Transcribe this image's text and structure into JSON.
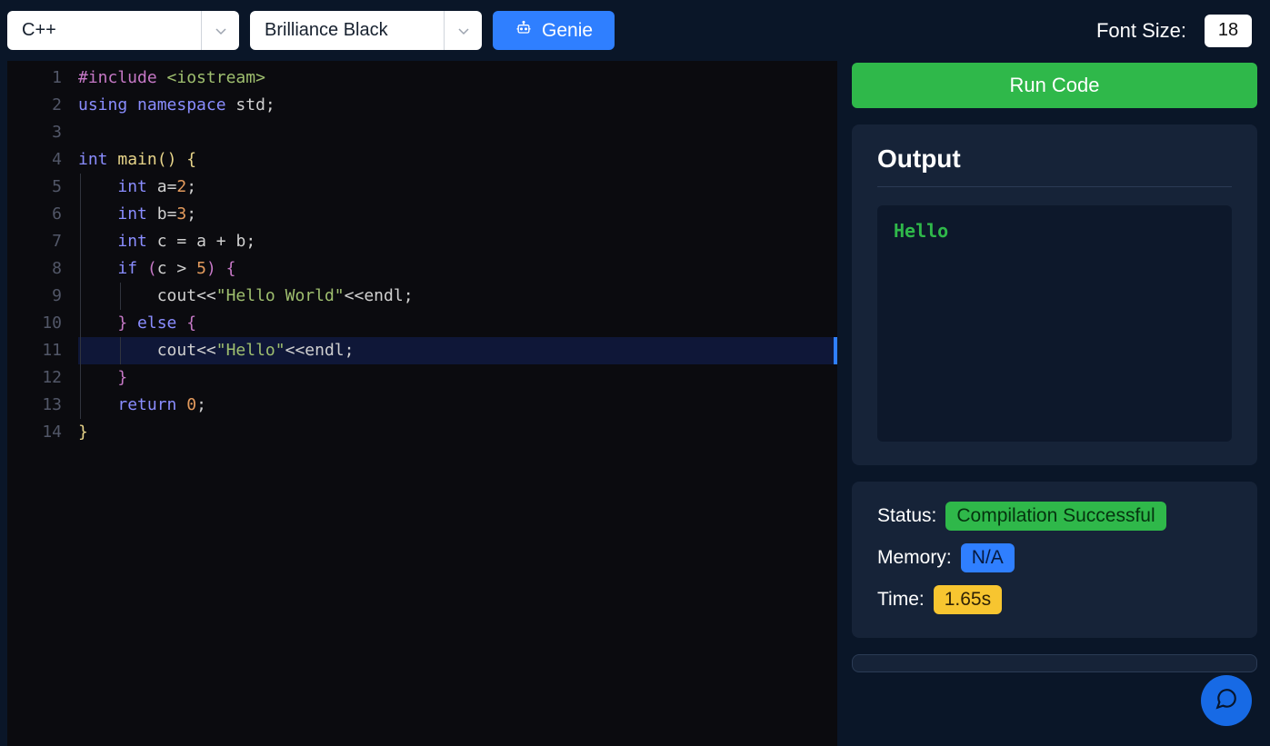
{
  "toolbar": {
    "language": "C++",
    "theme": "Brilliance Black",
    "genie_label": "Genie",
    "font_size_label": "Font Size:",
    "font_size_value": "18"
  },
  "editor": {
    "line_numbers": [
      "1",
      "2",
      "3",
      "4",
      "5",
      "6",
      "7",
      "8",
      "9",
      "10",
      "11",
      "12",
      "13",
      "14"
    ],
    "highlighted_line_index": 10,
    "lines": [
      {
        "tokens": [
          {
            "t": "#include ",
            "c": "include"
          },
          {
            "t": "<iostream>",
            "c": "str"
          }
        ]
      },
      {
        "tokens": [
          {
            "t": "using ",
            "c": "keyword"
          },
          {
            "t": "namespace ",
            "c": "keyword"
          },
          {
            "t": "std",
            "c": "ident"
          },
          {
            "t": ";",
            "c": "op"
          }
        ]
      },
      {
        "tokens": []
      },
      {
        "tokens": [
          {
            "t": "int ",
            "c": "type"
          },
          {
            "t": "main",
            "c": "func"
          },
          {
            "t": "(",
            "c": "punc-yellow"
          },
          {
            "t": ")",
            "c": "punc-yellow"
          },
          {
            "t": " ",
            "c": "plain"
          },
          {
            "t": "{",
            "c": "punc-yellow"
          }
        ]
      },
      {
        "indent": 1,
        "tokens": [
          {
            "t": "    ",
            "c": "plain"
          },
          {
            "t": "int ",
            "c": "type"
          },
          {
            "t": "a",
            "c": "ident"
          },
          {
            "t": "=",
            "c": "op"
          },
          {
            "t": "2",
            "c": "num"
          },
          {
            "t": ";",
            "c": "op"
          }
        ]
      },
      {
        "indent": 1,
        "tokens": [
          {
            "t": "    ",
            "c": "plain"
          },
          {
            "t": "int ",
            "c": "type"
          },
          {
            "t": "b",
            "c": "ident"
          },
          {
            "t": "=",
            "c": "op"
          },
          {
            "t": "3",
            "c": "num"
          },
          {
            "t": ";",
            "c": "op"
          }
        ]
      },
      {
        "indent": 1,
        "tokens": [
          {
            "t": "    ",
            "c": "plain"
          },
          {
            "t": "int ",
            "c": "type"
          },
          {
            "t": "c ",
            "c": "ident"
          },
          {
            "t": "= ",
            "c": "op"
          },
          {
            "t": "a ",
            "c": "ident"
          },
          {
            "t": "+ ",
            "c": "op"
          },
          {
            "t": "b",
            "c": "ident"
          },
          {
            "t": ";",
            "c": "op"
          }
        ]
      },
      {
        "indent": 1,
        "tokens": [
          {
            "t": "    ",
            "c": "plain"
          },
          {
            "t": "if ",
            "c": "keyword"
          },
          {
            "t": "(",
            "c": "punc-pink"
          },
          {
            "t": "c ",
            "c": "ident"
          },
          {
            "t": "> ",
            "c": "op"
          },
          {
            "t": "5",
            "c": "num"
          },
          {
            "t": ")",
            "c": "punc-pink"
          },
          {
            "t": " ",
            "c": "plain"
          },
          {
            "t": "{",
            "c": "punc-pink"
          }
        ]
      },
      {
        "indent": 2,
        "tokens": [
          {
            "t": "        ",
            "c": "plain"
          },
          {
            "t": "cout",
            "c": "ident"
          },
          {
            "t": "<<",
            "c": "op"
          },
          {
            "t": "\"Hello World\"",
            "c": "str"
          },
          {
            "t": "<<",
            "c": "op"
          },
          {
            "t": "endl",
            "c": "ident"
          },
          {
            "t": ";",
            "c": "op"
          }
        ]
      },
      {
        "indent": 1,
        "tokens": [
          {
            "t": "    ",
            "c": "plain"
          },
          {
            "t": "}",
            "c": "punc-pink"
          },
          {
            "t": " ",
            "c": "plain"
          },
          {
            "t": "else ",
            "c": "keyword"
          },
          {
            "t": "{",
            "c": "punc-pink"
          }
        ]
      },
      {
        "indent": 2,
        "tokens": [
          {
            "t": "        ",
            "c": "plain"
          },
          {
            "t": "cout",
            "c": "ident"
          },
          {
            "t": "<<",
            "c": "op"
          },
          {
            "t": "\"Hello\"",
            "c": "str"
          },
          {
            "t": "<<",
            "c": "op"
          },
          {
            "t": "endl",
            "c": "ident"
          },
          {
            "t": ";",
            "c": "op"
          }
        ]
      },
      {
        "indent": 1,
        "tokens": [
          {
            "t": "    ",
            "c": "plain"
          },
          {
            "t": "}",
            "c": "punc-pink"
          }
        ]
      },
      {
        "indent": 1,
        "tokens": [
          {
            "t": "    ",
            "c": "plain"
          },
          {
            "t": "return ",
            "c": "keyword"
          },
          {
            "t": "0",
            "c": "num"
          },
          {
            "t": ";",
            "c": "op"
          }
        ]
      },
      {
        "tokens": [
          {
            "t": "}",
            "c": "punc-yellow"
          }
        ]
      }
    ]
  },
  "run_button_label": "Run Code",
  "output_panel": {
    "title": "Output",
    "text": "Hello"
  },
  "status_panel": {
    "status_label": "Status:",
    "status_value": "Compilation Successful",
    "memory_label": "Memory:",
    "memory_value": "N/A",
    "time_label": "Time:",
    "time_value": "1.65s"
  }
}
